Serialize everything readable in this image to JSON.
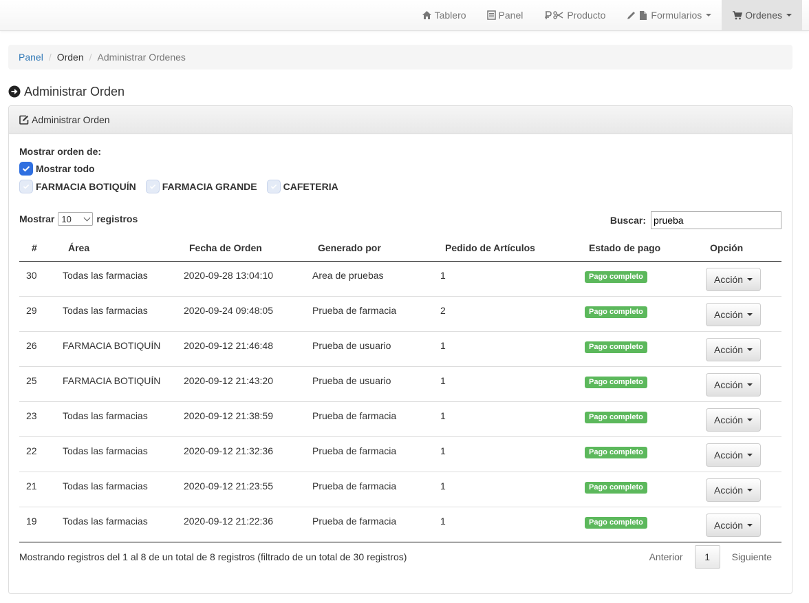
{
  "nav": {
    "items": [
      {
        "label": "Tablero",
        "icon": "home-icon"
      },
      {
        "label": "Panel",
        "icon": "list-icon"
      },
      {
        "label": "Producto",
        "icon": "product-icon"
      },
      {
        "label": "Formularios",
        "icon": "pencil-file-icon"
      },
      {
        "label": "Ordenes",
        "icon": "cart-icon"
      }
    ]
  },
  "breadcrumb": {
    "panel": "Panel",
    "orden": "Orden",
    "current": "Administrar Ordenes",
    "separator": "/"
  },
  "page_title": "Administrar Orden",
  "panel": {
    "heading": "Administrar Orden"
  },
  "filters": {
    "label": "Mostrar orden de:",
    "show_all": "Mostrar todo",
    "options": [
      "FARMACIA BOTIQUÍN",
      "FARMACIA GRANDE",
      "CAFETERIA"
    ]
  },
  "length": {
    "prefix": "Mostrar",
    "value": "10",
    "suffix": "registros"
  },
  "search": {
    "label": "Buscar:",
    "value": "prueba"
  },
  "table": {
    "headers": [
      "#",
      "Área",
      "Fecha de Orden",
      "Generado por",
      "Pedido de Artículos",
      "Estado de pago",
      "Opción"
    ],
    "rows": [
      {
        "id": "30",
        "area": "Todas las farmacias",
        "fecha": "2020-09-28 13:04:10",
        "generado": "Area de pruebas",
        "pedido": "1",
        "estado": "Pago completo",
        "accion": "Acción"
      },
      {
        "id": "29",
        "area": "Todas las farmacias",
        "fecha": "2020-09-24 09:48:05",
        "generado": "Prueba de farmacia",
        "pedido": "2",
        "estado": "Pago completo",
        "accion": "Acción"
      },
      {
        "id": "26",
        "area": "FARMACIA BOTIQUÍN",
        "fecha": "2020-09-12 21:46:48",
        "generado": "Prueba de usuario",
        "pedido": "1",
        "estado": "Pago completo",
        "accion": "Acción"
      },
      {
        "id": "25",
        "area": "FARMACIA BOTIQUÍN",
        "fecha": "2020-09-12 21:43:20",
        "generado": "Prueba de usuario",
        "pedido": "1",
        "estado": "Pago completo",
        "accion": "Acción"
      },
      {
        "id": "23",
        "area": "Todas las farmacias",
        "fecha": "2020-09-12 21:38:59",
        "generado": "Prueba de farmacia",
        "pedido": "1",
        "estado": "Pago completo",
        "accion": "Acción"
      },
      {
        "id": "22",
        "area": "Todas las farmacias",
        "fecha": "2020-09-12 21:32:36",
        "generado": "Prueba de farmacia",
        "pedido": "1",
        "estado": "Pago completo",
        "accion": "Acción"
      },
      {
        "id": "21",
        "area": "Todas las farmacias",
        "fecha": "2020-09-12 21:23:55",
        "generado": "Prueba de farmacia",
        "pedido": "1",
        "estado": "Pago completo",
        "accion": "Acción"
      },
      {
        "id": "19",
        "area": "Todas las farmacias",
        "fecha": "2020-09-12 21:22:36",
        "generado": "Prueba de farmacia",
        "pedido": "1",
        "estado": "Pago completo",
        "accion": "Acción"
      }
    ]
  },
  "info": "Mostrando registros del 1 al 8 de un total de 8 registros (filtrado de un total de 30 registros)",
  "pagination": {
    "previous": "Anterior",
    "page": "1",
    "next": "Siguiente"
  },
  "colors": {
    "link": "#337ab7",
    "success": "#5cb85c",
    "checkbox_on": "#2f6fe0"
  }
}
